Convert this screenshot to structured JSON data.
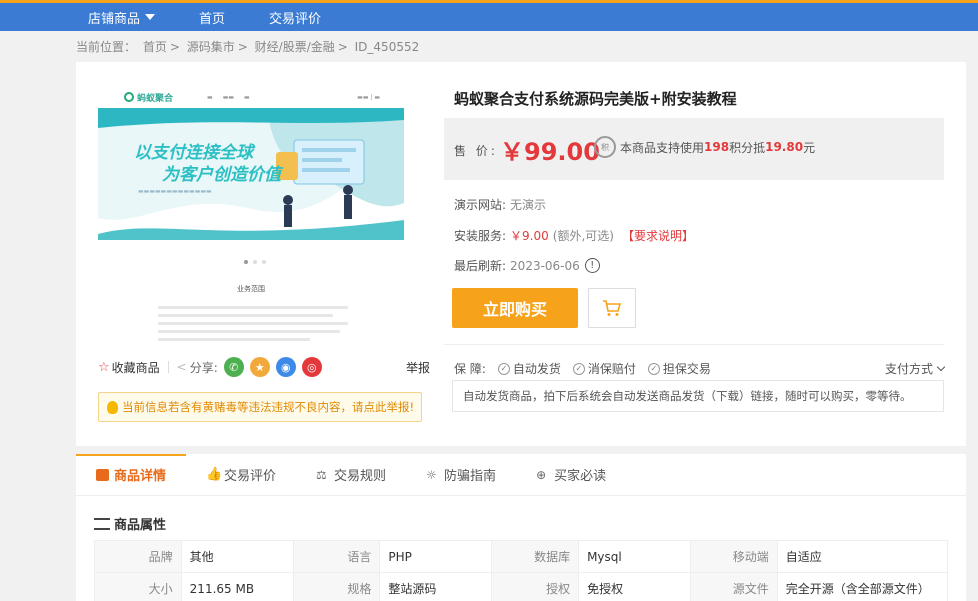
{
  "topnav": {
    "items": [
      "店铺商品",
      "首页",
      "交易评价"
    ]
  },
  "breadcrumb": {
    "prefix": "当前位置：",
    "items": [
      "首页",
      "源码集市",
      "财经/股票/金融",
      "ID_450552"
    ],
    "separator": ">"
  },
  "preview": {
    "logo_text": "蚂蚁聚合",
    "banner_line1": "以支付连接全球",
    "banner_line2": "为客户创造价值",
    "section_title": "业务范围"
  },
  "actions": {
    "favorite": "收藏商品",
    "share": "分享:",
    "report": "举报",
    "share_icons": [
      "wechat-icon",
      "qzone-icon",
      "qq-icon",
      "weibo-icon"
    ]
  },
  "warning": "当前信息若含有黄赌毒等违法违规不良内容，请点此举报!",
  "product": {
    "title": "蚂蚁聚合支付系统源码完美版+附安装教程",
    "price_label": "售 价:",
    "price": "￥99.00",
    "points_text_pre": "本商品支持使用",
    "points_count": "198",
    "points_text_mid": "积分抵",
    "points_value": "19.80",
    "points_text_post": "元",
    "demo_label": "演示网站:",
    "demo_value": "无演示",
    "install_label": "安装服务:",
    "install_price": "￥9.00",
    "install_sub": "(额外,可选)",
    "install_req": "【要求说明】",
    "refresh_label": "最后刷新:",
    "refresh_value": "2023-06-06",
    "buy_label": "立即购买",
    "guarantee_label": "保 障:",
    "guarantees": [
      "自动发货",
      "消保赔付",
      "担保交易"
    ],
    "pay_method": "支付方式",
    "auto_text": "自动发货商品，拍下后系统会自动发送商品发货（下载）链接，随时可以购买，零等待。"
  },
  "tabs": [
    "商品详情",
    "交易评价",
    "交易规则",
    "防骗指南",
    "买家必读"
  ],
  "attributes": {
    "title": "商品属性",
    "rows": [
      [
        [
          "品牌",
          "其他"
        ],
        [
          "语言",
          "PHP"
        ],
        [
          "数据库",
          "Mysql"
        ],
        [
          "移动端",
          "自适应"
        ]
      ],
      [
        [
          "大小",
          "211.65 MB"
        ],
        [
          "规格",
          "整站源码"
        ],
        [
          "授权",
          "免授权"
        ],
        [
          "源文件",
          "完全开源（含全部源文件）"
        ]
      ]
    ]
  },
  "colors": {
    "topbar": "#3b7bd4",
    "accent": "#f7a21b",
    "price": "#e4393c"
  }
}
